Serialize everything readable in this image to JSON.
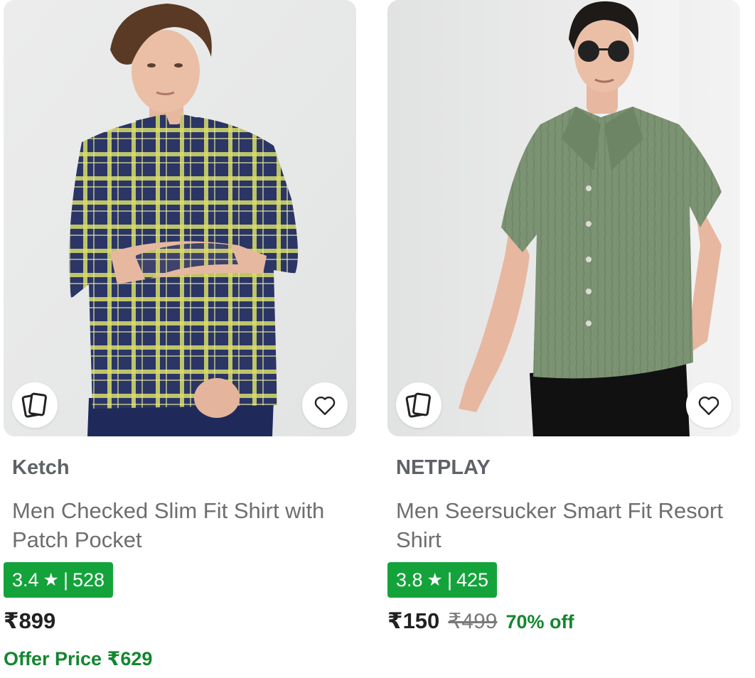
{
  "products": [
    {
      "brand": "Ketch",
      "title": "Men Checked Slim Fit Shirt with Patch Pocket",
      "rating": "3.4",
      "rating_count": "528",
      "price": "₹899",
      "offer_price": "Offer Price ₹629",
      "image_icon": "model-checked-shirt-image",
      "colors": {
        "shirt": "#2b3566",
        "check": "#d9dd6a",
        "background": "#e8e9e9"
      }
    },
    {
      "brand": "NETPLAY",
      "title": "Men Seersucker Smart Fit Resort Shirt",
      "rating": "3.8",
      "rating_count": "425",
      "price": "₹150",
      "mrp": "₹499",
      "discount": "70% off",
      "image_icon": "model-green-shirt-image",
      "colors": {
        "shirt": "#7c9373",
        "background": "#e7e8e8"
      }
    }
  ],
  "icons": {
    "similar": "similar-products-icon",
    "wishlist": "heart-icon",
    "star": "★",
    "separator": "|"
  },
  "colors": {
    "rating_badge": "#14a33b",
    "discount_text": "#14862f",
    "brand_text": "#5f6368",
    "title_text": "#6e6e6e"
  }
}
